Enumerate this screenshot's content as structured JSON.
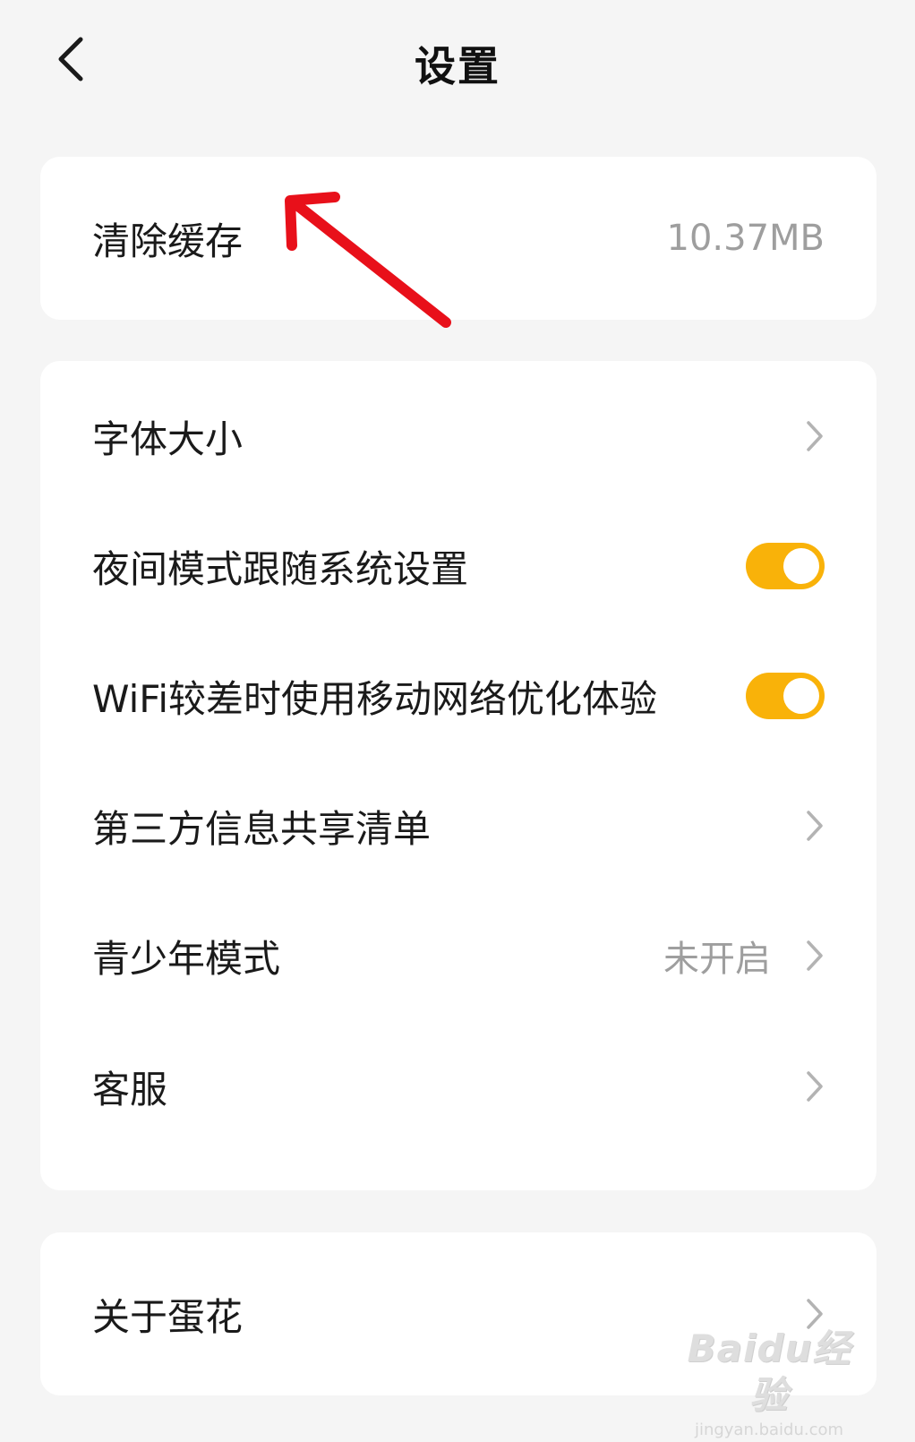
{
  "header": {
    "title": "设置",
    "back_icon": "chevron-left-icon"
  },
  "cache": {
    "label": "清除缓存",
    "value": "10.37MB"
  },
  "settings": {
    "font_size": {
      "label": "字体大小"
    },
    "night_mode": {
      "label": "夜间模式跟随系统设置",
      "enabled": true
    },
    "wifi_optimize": {
      "label": "WiFi较差时使用移动网络优化体验",
      "enabled": true
    },
    "third_party": {
      "label": "第三方信息共享清单"
    },
    "youth_mode": {
      "label": "青少年模式",
      "value": "未开启"
    },
    "customer_service": {
      "label": "客服"
    }
  },
  "about": {
    "label": "关于蛋花"
  },
  "watermark": {
    "logo": "Baidu经验",
    "url": "jingyan.baidu.com"
  },
  "colors": {
    "background": "#f5f5f5",
    "card": "#ffffff",
    "toggle_on": "#f9b209",
    "annotation_arrow": "#e8101a",
    "secondary_text": "#9e9e9e"
  }
}
